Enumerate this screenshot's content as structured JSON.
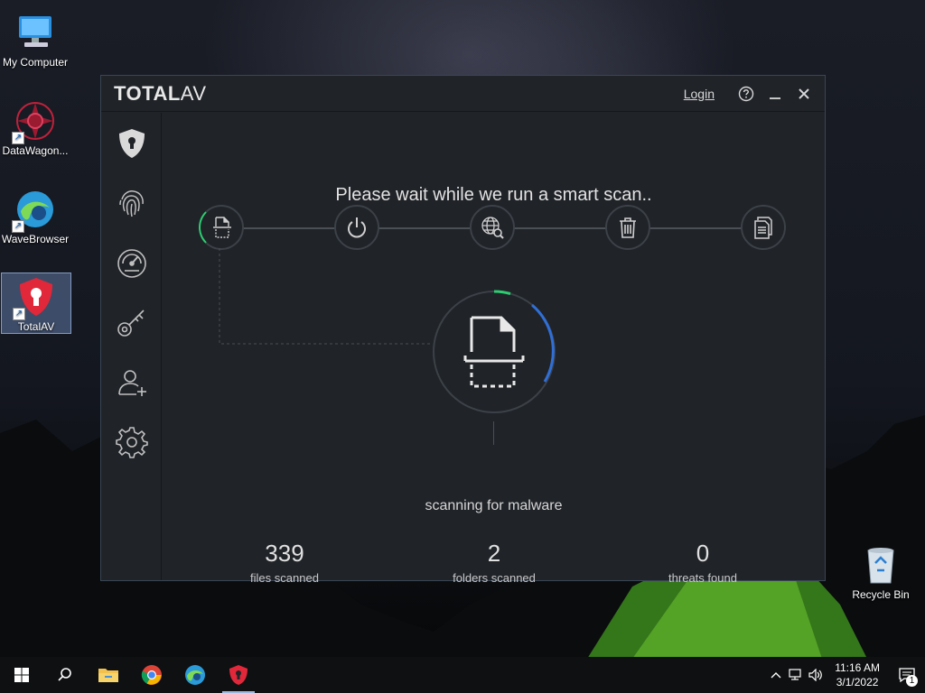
{
  "desktop": {
    "icons": [
      {
        "label": "My Computer",
        "icon": "computer-icon"
      },
      {
        "label": "DataWagon...",
        "icon": "datawagon-icon"
      },
      {
        "label": "WaveBrowser",
        "icon": "wavebrowser-icon"
      },
      {
        "label": "TotalAV",
        "icon": "totalav-shield-icon"
      },
      {
        "label": "Recycle Bin",
        "icon": "recycle-bin-icon"
      }
    ]
  },
  "app": {
    "logo_bold": "TOTAL",
    "logo_light": "AV",
    "login_label": "Login",
    "sidebar": [
      {
        "name": "protection",
        "icon": "shield-icon"
      },
      {
        "name": "identity",
        "icon": "fingerprint-icon"
      },
      {
        "name": "performance",
        "icon": "speedometer-icon"
      },
      {
        "name": "passwords",
        "icon": "key-icon"
      },
      {
        "name": "add-user",
        "icon": "add-user-icon"
      },
      {
        "name": "settings",
        "icon": "gear-icon"
      }
    ],
    "headline": "Please wait while we run a smart scan..",
    "steps": [
      {
        "name": "file-scan",
        "icon": "file-scan-icon"
      },
      {
        "name": "startup",
        "icon": "power-icon"
      },
      {
        "name": "web",
        "icon": "globe-search-icon"
      },
      {
        "name": "junk",
        "icon": "trash-icon"
      },
      {
        "name": "report",
        "icon": "documents-icon"
      }
    ],
    "scan_status": "scanning for malware",
    "stats": [
      {
        "value": "339",
        "label": "files scanned"
      },
      {
        "value": "2",
        "label": "folders scanned"
      },
      {
        "value": "0",
        "label": "threats found"
      }
    ],
    "colors": {
      "accent_green": "#2ecc71",
      "accent_blue": "#2f6fd6",
      "bg": "#202328"
    }
  },
  "taskbar": {
    "time": "11:16 AM",
    "date": "3/1/2022",
    "notification_count": "1",
    "apps": [
      "start-icon",
      "search-icon",
      "file-explorer-icon",
      "chrome-icon",
      "wavebrowser-icon",
      "totalav-icon"
    ]
  }
}
